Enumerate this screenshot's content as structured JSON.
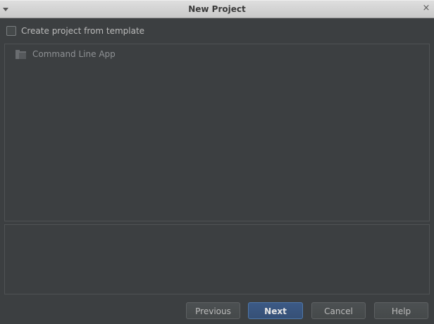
{
  "window": {
    "title": "New Project",
    "close_glyph": "×",
    "menu_icon": "dropdown-arrow-icon"
  },
  "template": {
    "checkbox_label": "Create project from template",
    "checked": false
  },
  "template_list": {
    "items": [
      {
        "label": "Command Line App",
        "icon": "folder-icon"
      }
    ]
  },
  "buttons": {
    "previous": "Previous",
    "next": "Next",
    "cancel": "Cancel",
    "help": "Help"
  },
  "colors": {
    "background": "#3c3f41",
    "titlebar": "#d4d4d4",
    "primary_button": "#365880",
    "text": "#bbbbbb"
  }
}
